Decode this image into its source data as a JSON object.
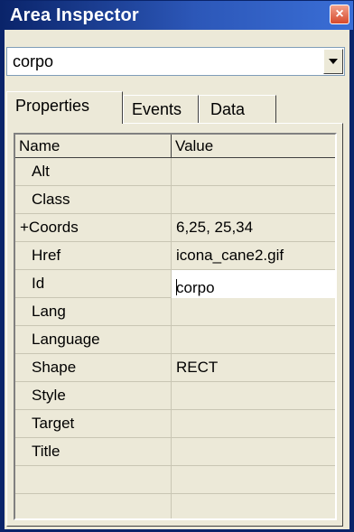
{
  "window": {
    "title": "Area Inspector",
    "close_glyph": "×"
  },
  "element_select": {
    "value": "corpo",
    "arrow_icon": "chevron-down-icon"
  },
  "tabs": [
    {
      "label": "Properties",
      "active": true
    },
    {
      "label": "Events",
      "active": false
    },
    {
      "label": "Data",
      "active": false
    }
  ],
  "grid": {
    "headers": {
      "name": "Name",
      "value": "Value"
    },
    "rows": [
      {
        "name": "Alt",
        "value": ""
      },
      {
        "name": "Class",
        "value": ""
      },
      {
        "name": "+Coords",
        "value": "6,25, 25,34"
      },
      {
        "name": "Href",
        "value": "icona_cane2.gif"
      },
      {
        "name": "Id",
        "value": "corpo",
        "editing": true
      },
      {
        "name": "Lang",
        "value": ""
      },
      {
        "name": "Language",
        "value": ""
      },
      {
        "name": "Shape",
        "value": "RECT"
      },
      {
        "name": "Style",
        "value": ""
      },
      {
        "name": "Target",
        "value": ""
      },
      {
        "name": "Title",
        "value": ""
      }
    ]
  },
  "colors": {
    "titlebar": "#0a246a",
    "face": "#ece9d8",
    "close": "#d6492b"
  }
}
